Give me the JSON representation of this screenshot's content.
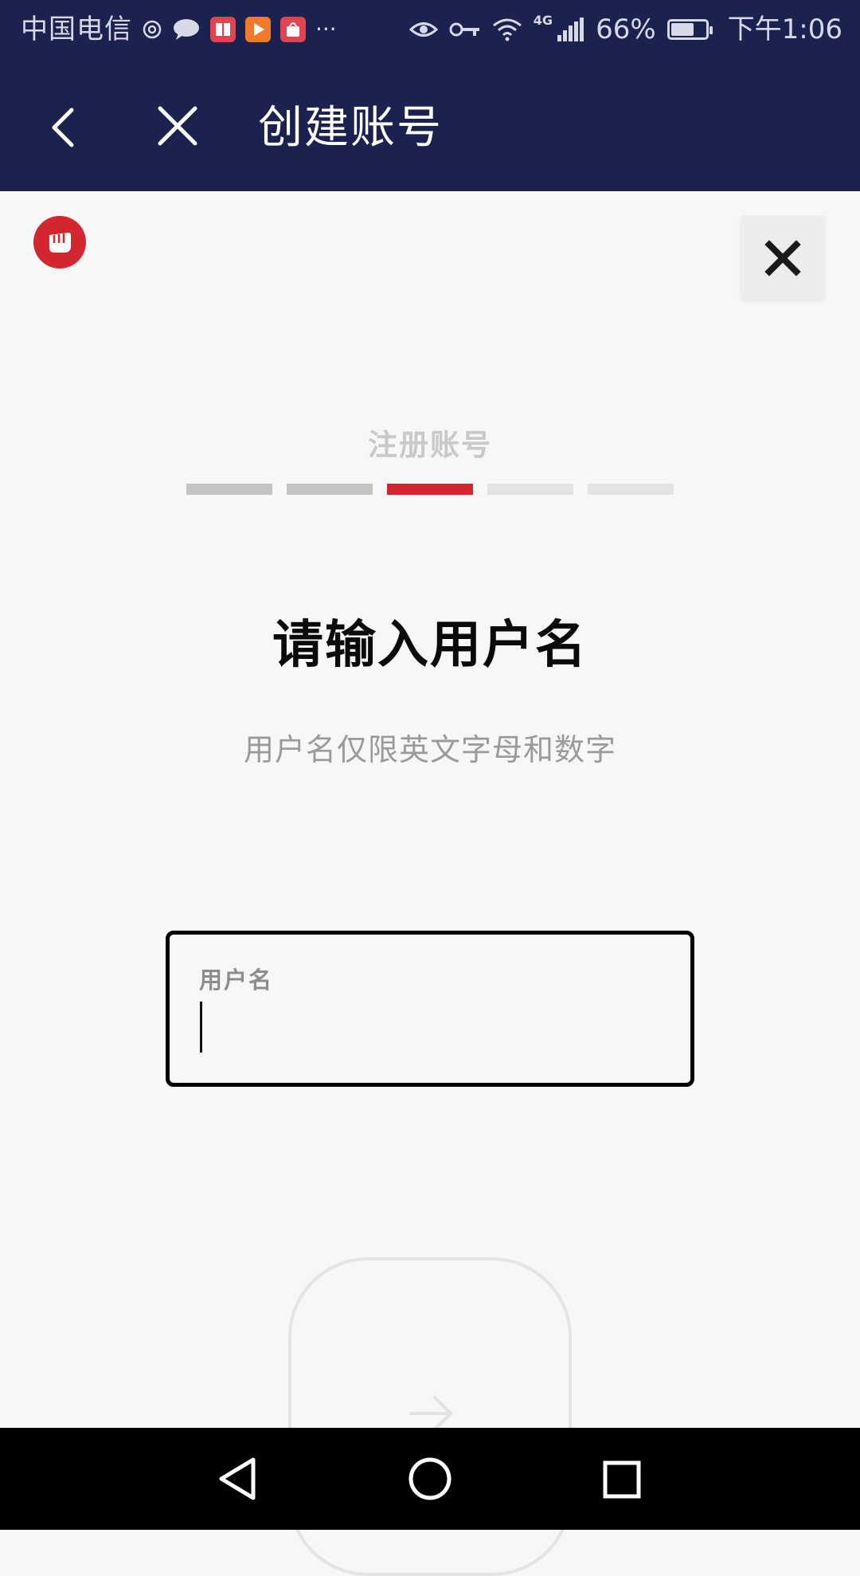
{
  "status_bar": {
    "carrier": "中国电信",
    "network": "4G",
    "battery": "66%",
    "battery_level": 0.66,
    "time": "下午1:06",
    "overflow": "···"
  },
  "app_bar": {
    "title": "创建账号",
    "back_icon": "chevron-left-icon",
    "close_icon": "close-icon"
  },
  "page": {
    "logo_icon": "fist-logo-icon",
    "dismiss_icon": "close-icon",
    "step_title": "注册账号",
    "progress": {
      "total_steps": 5,
      "current_step": 3,
      "colors": {
        "done": "#c4c4c4",
        "current": "#d4262e",
        "todo": "#e3e3e3"
      }
    },
    "heading": "请输入用户名",
    "subtext": "用户名仅限英文字母和数字",
    "username_field": {
      "label": "用户名",
      "value": ""
    },
    "next_icon": "arrow-right-icon"
  },
  "colors": {
    "header_bg": "#1c2250",
    "accent": "#d4262e",
    "page_bg": "#f7f7f7"
  }
}
